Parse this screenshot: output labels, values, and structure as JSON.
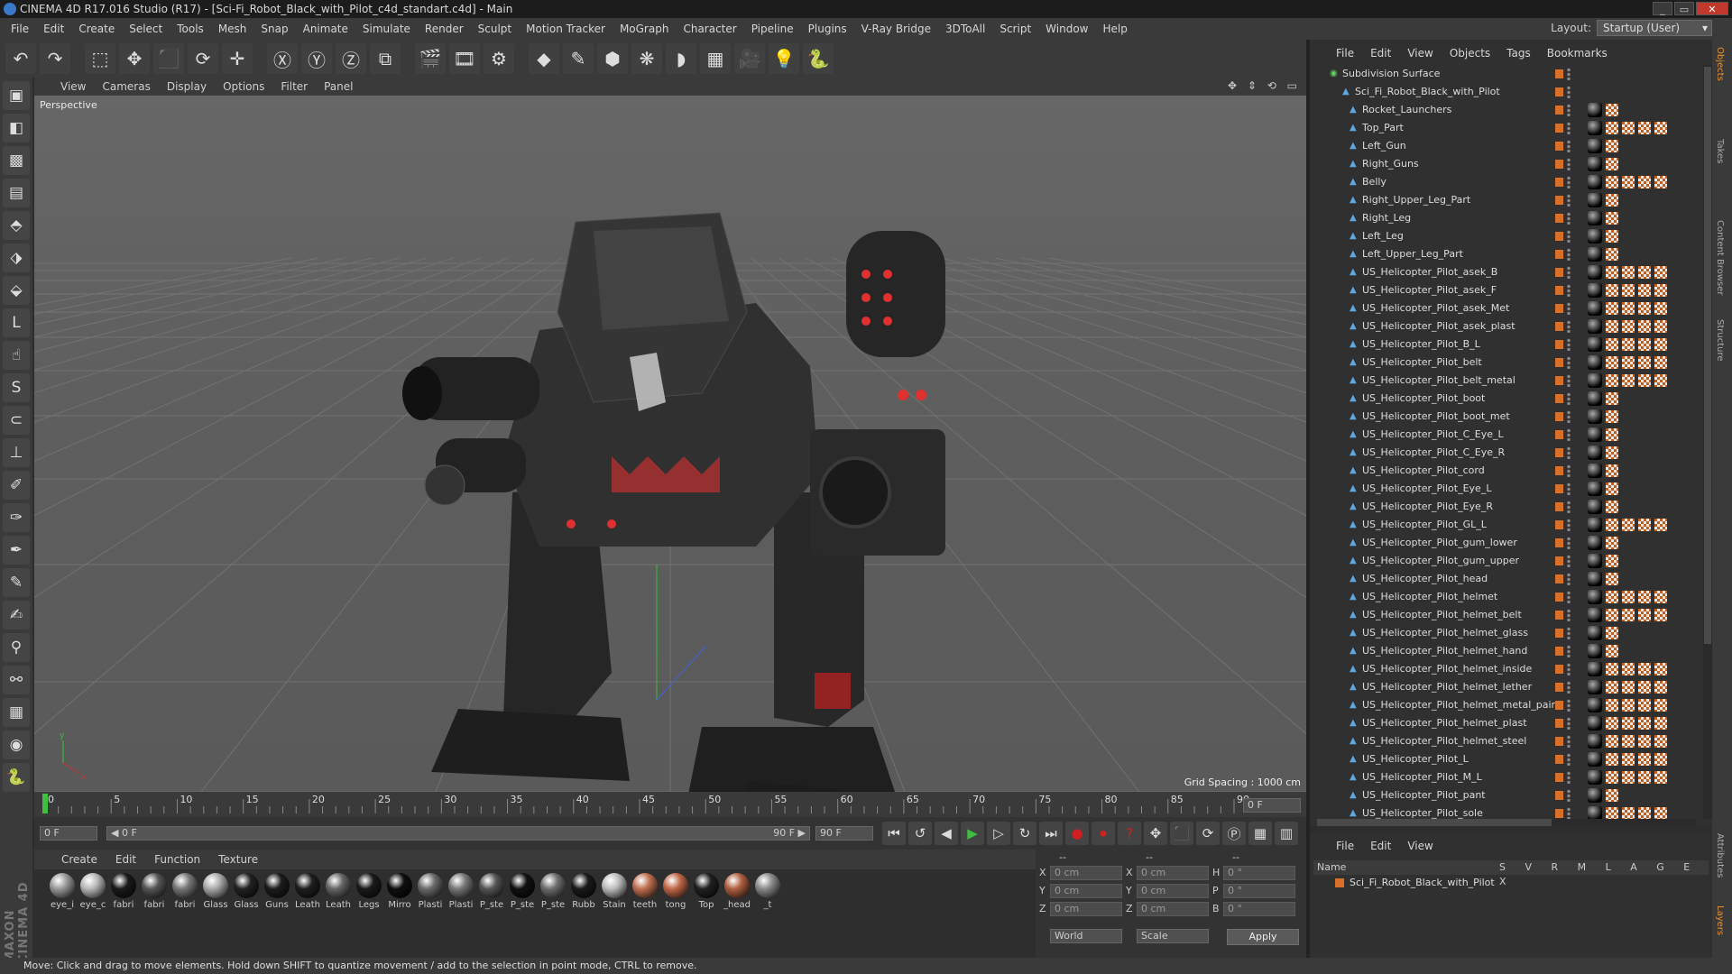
{
  "window": {
    "title": "CINEMA 4D R17.016 Studio (R17) - [Sci-Fi_Robot_Black_with_Pilot_c4d_standart.c4d] - Main",
    "min": "_",
    "max": "▭",
    "close": "✕"
  },
  "menu": [
    "File",
    "Edit",
    "Create",
    "Select",
    "Tools",
    "Mesh",
    "Snap",
    "Animate",
    "Simulate",
    "Render",
    "Sculpt",
    "Motion Tracker",
    "MoGraph",
    "Character",
    "Pipeline",
    "Plugins",
    "V-Ray Bridge",
    "3DToAll",
    "Script",
    "Window",
    "Help"
  ],
  "layout": {
    "label": "Layout:",
    "value": "Startup (User)"
  },
  "toolbar": [
    {
      "name": "undo-icon",
      "g": "↶"
    },
    {
      "name": "redo-icon",
      "g": "↷"
    },
    {
      "sep": true
    },
    {
      "name": "live-selection-icon",
      "g": "⬚"
    },
    {
      "name": "move-icon",
      "g": "✥"
    },
    {
      "name": "scale-icon",
      "g": "⬛"
    },
    {
      "name": "rotate-icon",
      "g": "⟳"
    },
    {
      "name": "last-tool-icon",
      "g": "✛"
    },
    {
      "sep": true
    },
    {
      "name": "x-axis-icon",
      "g": "Ⓧ"
    },
    {
      "name": "y-axis-icon",
      "g": "Ⓨ"
    },
    {
      "name": "z-axis-icon",
      "g": "Ⓩ"
    },
    {
      "name": "coordinate-system-icon",
      "g": "⧉"
    },
    {
      "sep": true
    },
    {
      "name": "render-view-icon",
      "g": "🎬"
    },
    {
      "name": "render-picture-viewer-icon",
      "g": "🎞"
    },
    {
      "name": "edit-render-settings-icon",
      "g": "⚙"
    },
    {
      "sep": true
    },
    {
      "name": "cube-icon",
      "g": "◆"
    },
    {
      "name": "pen-spline-icon",
      "g": "✎"
    },
    {
      "name": "subdivision-icon",
      "g": "⬢"
    },
    {
      "name": "cloner-icon",
      "g": "❋"
    },
    {
      "name": "deformer-icon",
      "g": "◗"
    },
    {
      "name": "floor-icon",
      "g": "▦"
    },
    {
      "name": "camera-icon",
      "g": "🎥"
    },
    {
      "name": "light-icon",
      "g": "💡"
    },
    {
      "name": "python-icon",
      "g": "🐍"
    }
  ],
  "lefttools": [
    {
      "name": "make-editable-icon",
      "g": "▣"
    },
    {
      "name": "model-mode-icon",
      "g": "◧"
    },
    {
      "name": "texture-mode-icon",
      "g": "▩"
    },
    {
      "name": "workplane-icon",
      "g": "▤"
    },
    {
      "name": "points-mode-icon",
      "g": "⬘"
    },
    {
      "name": "edges-mode-icon",
      "g": "⬗"
    },
    {
      "name": "polygons-mode-icon",
      "g": "⬙"
    },
    {
      "name": "axis-icon",
      "g": "L"
    },
    {
      "name": "tweak-icon",
      "g": "☝"
    },
    {
      "name": "snap-icon",
      "g": "S"
    },
    {
      "name": "magnet-icon",
      "g": "⊂"
    },
    {
      "name": "workplane-axis-icon",
      "g": "⊥"
    },
    {
      "name": "brush-1-icon",
      "g": "✐"
    },
    {
      "name": "brush-2-icon",
      "g": "✑"
    },
    {
      "name": "brush-3-icon",
      "g": "✒"
    },
    {
      "name": "brush-4-icon",
      "g": "✎"
    },
    {
      "name": "brush-5-icon",
      "g": "✍"
    },
    {
      "name": "brush-6-icon",
      "g": "⚲"
    },
    {
      "name": "brush-7-icon",
      "g": "⚯"
    },
    {
      "name": "lock-grid-icon",
      "g": "▦"
    },
    {
      "name": "solo-icon",
      "g": "◉"
    },
    {
      "name": "python-script-icon",
      "g": "🐍"
    }
  ],
  "viewport": {
    "menu": [
      "View",
      "Cameras",
      "Display",
      "Options",
      "Filter",
      "Panel"
    ],
    "label": "Perspective",
    "grid_spacing": "Grid Spacing : 1000 cm",
    "icons": "✥ ⇕ ⟲ ▭"
  },
  "timeline": {
    "ticks": [
      "0",
      "5",
      "10",
      "15",
      "20",
      "25",
      "30",
      "35",
      "40",
      "45",
      "50",
      "55",
      "60",
      "65",
      "70",
      "75",
      "80",
      "85",
      "90"
    ],
    "current_frame": "0 F",
    "start_field": "0 F",
    "range_start": "◀ 0 F",
    "range_end": "90 F ▶",
    "end_field": "90 F"
  },
  "playback": [
    {
      "name": "go-to-start-icon",
      "g": "⏮"
    },
    {
      "name": "previous-key-icon",
      "g": "↺"
    },
    {
      "name": "previous-frame-icon",
      "g": "◀"
    },
    {
      "name": "play-icon",
      "g": "▶"
    },
    {
      "name": "next-frame-icon",
      "g": "▷"
    },
    {
      "name": "next-key-icon",
      "g": "↻"
    },
    {
      "name": "go-to-end-icon",
      "g": "⏭"
    },
    {
      "name": "record-keys-icon",
      "g": "●"
    },
    {
      "name": "auto-key-icon",
      "g": "⏺"
    },
    {
      "name": "keyframe-selection-icon",
      "g": "?"
    },
    {
      "name": "key-position-icon",
      "g": "✥"
    },
    {
      "name": "key-scale-icon",
      "g": "⬛"
    },
    {
      "name": "key-rotation-icon",
      "g": "⟳"
    },
    {
      "name": "key-parameter-icon",
      "g": "Ⓟ"
    },
    {
      "name": "key-pla-icon",
      "g": "▦"
    },
    {
      "name": "timeline-window-icon",
      "g": "▥"
    }
  ],
  "materials": {
    "menu": [
      "Create",
      "Edit",
      "Function",
      "Texture"
    ],
    "items": [
      {
        "label": "eye_i",
        "color": "#9a9a9a"
      },
      {
        "label": "eye_c",
        "color": "#b8b8b8"
      },
      {
        "label": "fabri",
        "color": "#1a1a1a"
      },
      {
        "label": "fabri",
        "color": "#555555"
      },
      {
        "label": "fabri",
        "color": "#777777"
      },
      {
        "label": "Glass",
        "color": "#aaaaaa"
      },
      {
        "label": "Glass",
        "color": "#222222"
      },
      {
        "label": "Guns",
        "color": "#1c1c1c"
      },
      {
        "label": "Leath",
        "color": "#1e1e1e"
      },
      {
        "label": "Leath",
        "color": "#666666"
      },
      {
        "label": "Legs",
        "color": "#1a1a1a"
      },
      {
        "label": "Mirro",
        "color": "#0e0e0e"
      },
      {
        "label": "Plasti",
        "color": "#6a6a6a"
      },
      {
        "label": "Plasti",
        "color": "#777777"
      },
      {
        "label": "P_ste",
        "color": "#555555"
      },
      {
        "label": "P_ste",
        "color": "#111111"
      },
      {
        "label": "P_ste",
        "color": "#6e6e6e"
      },
      {
        "label": "Rubb",
        "color": "#1a1a1a"
      },
      {
        "label": "Stain",
        "color": "#bdbdbd"
      },
      {
        "label": "teeth",
        "color": "#c07050"
      },
      {
        "label": "tong",
        "color": "#c06848"
      },
      {
        "label": "Top",
        "color": "#202020"
      },
      {
        "label": "_head",
        "color": "#b06040"
      },
      {
        "label": "_t",
        "color": "#8a8a8a"
      }
    ]
  },
  "coords": {
    "header": [
      "--",
      "--",
      "--"
    ],
    "rows": [
      {
        "a": "X",
        "av": "0 cm",
        "b": "X",
        "bv": "0 cm",
        "c": "H",
        "cv": "0 °"
      },
      {
        "a": "Y",
        "av": "0 cm",
        "b": "Y",
        "bv": "0 cm",
        "c": "P",
        "cv": "0 °"
      },
      {
        "a": "Z",
        "av": "0 cm",
        "b": "Z",
        "bv": "0 cm",
        "c": "B",
        "cv": "0 °"
      }
    ],
    "world": "World",
    "scale": "Scale",
    "apply": "Apply"
  },
  "status": "Move: Click and drag to move elements. Hold down SHIFT to quantize movement / add to the selection in point mode, CTRL to remove.",
  "objects": {
    "menu": [
      "File",
      "Edit",
      "View",
      "Objects",
      "Tags",
      "Bookmarks"
    ],
    "root": "Subdivision Surface",
    "group": "Sci_Fi_Robot_Black_with_Pilot",
    "items": [
      {
        "n": "Rocket_Launchers",
        "t": 1
      },
      {
        "n": "Top_Part",
        "t": 4
      },
      {
        "n": "Left_Gun",
        "t": 1
      },
      {
        "n": "Right_Guns",
        "t": 1
      },
      {
        "n": "Belly",
        "t": 4
      },
      {
        "n": "Right_Upper_Leg_Part",
        "t": 1
      },
      {
        "n": "Right_Leg",
        "t": 1
      },
      {
        "n": "Left_Leg",
        "t": 1
      },
      {
        "n": "Left_Upper_Leg_Part",
        "t": 1
      },
      {
        "n": "US_Helicopter_Pilot_asek_B",
        "t": 4
      },
      {
        "n": "US_Helicopter_Pilot_asek_F",
        "t": 4
      },
      {
        "n": "US_Helicopter_Pilot_asek_Met",
        "t": 4
      },
      {
        "n": "US_Helicopter_Pilot_asek_plast",
        "t": 4
      },
      {
        "n": "US_Helicopter_Pilot_B_L",
        "t": 4
      },
      {
        "n": "US_Helicopter_Pilot_belt",
        "t": 4
      },
      {
        "n": "US_Helicopter_Pilot_belt_metal",
        "t": 4
      },
      {
        "n": "US_Helicopter_Pilot_boot",
        "t": 1
      },
      {
        "n": "US_Helicopter_Pilot_boot_met",
        "t": 1
      },
      {
        "n": "US_Helicopter_Pilot_C_Eye_L",
        "t": 1
      },
      {
        "n": "US_Helicopter_Pilot_C_Eye_R",
        "t": 1
      },
      {
        "n": "US_Helicopter_Pilot_cord",
        "t": 1
      },
      {
        "n": "US_Helicopter_Pilot_Eye_L",
        "t": 1
      },
      {
        "n": "US_Helicopter_Pilot_Eye_R",
        "t": 1
      },
      {
        "n": "US_Helicopter_Pilot_GL_L",
        "t": 4
      },
      {
        "n": "US_Helicopter_Pilot_gum_lower",
        "t": 1
      },
      {
        "n": "US_Helicopter_Pilot_gum_upper",
        "t": 1
      },
      {
        "n": "US_Helicopter_Pilot_head",
        "t": 1
      },
      {
        "n": "US_Helicopter_Pilot_helmet",
        "t": 4
      },
      {
        "n": "US_Helicopter_Pilot_helmet_belt",
        "t": 4
      },
      {
        "n": "US_Helicopter_Pilot_helmet_glass",
        "t": 1
      },
      {
        "n": "US_Helicopter_Pilot_helmet_hand",
        "t": 1
      },
      {
        "n": "US_Helicopter_Pilot_helmet_inside",
        "t": 4
      },
      {
        "n": "US_Helicopter_Pilot_helmet_lether",
        "t": 4
      },
      {
        "n": "US_Helicopter_Pilot_helmet_metal_paint",
        "t": 4
      },
      {
        "n": "US_Helicopter_Pilot_helmet_plast",
        "t": 4
      },
      {
        "n": "US_Helicopter_Pilot_helmet_steel",
        "t": 4
      },
      {
        "n": "US_Helicopter_Pilot_L",
        "t": 4
      },
      {
        "n": "US_Helicopter_Pilot_M_L",
        "t": 4
      },
      {
        "n": "US_Helicopter_Pilot_pant",
        "t": 1
      },
      {
        "n": "US_Helicopter_Pilot_sole",
        "t": 4
      }
    ]
  },
  "layers": {
    "menu": [
      "File",
      "Edit",
      "View"
    ],
    "header_name": "Name",
    "header_cols": "S V R M L A G E X",
    "row": "Sci_Fi_Robot_Black_with_Pilot"
  },
  "right_tabs": [
    "Objects",
    "Takes",
    "Content Browser",
    "Structure",
    "Attributes",
    "Layers"
  ],
  "colors": {
    "accent": "#d8702a",
    "selection": "#e89030",
    "play": "#3fbf3f",
    "record": "#d02020"
  }
}
